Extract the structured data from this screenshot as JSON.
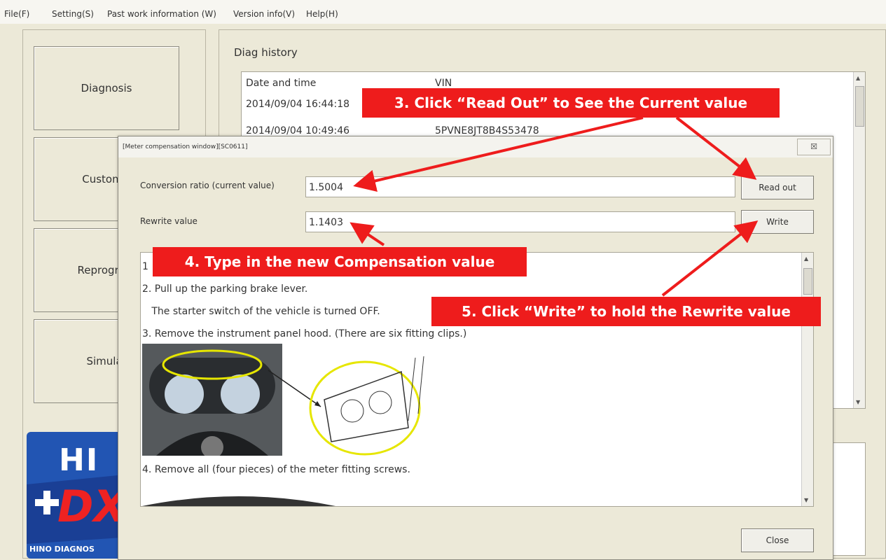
{
  "menu": {
    "file": "File(F)",
    "setting": "Setting(S)",
    "past_work": "Past work information (W)",
    "version": "Version info(V)",
    "help": "Help(H)"
  },
  "sidebar": {
    "diagnosis": "Diagnosis",
    "customize": "Customiz",
    "reprogram": "Reprogram",
    "simulation": "Simulat"
  },
  "logo": {
    "line1": "HI",
    "line2": "DX",
    "subtitle": "HINO DIAGNOS"
  },
  "diag_history": {
    "title": "Diag history",
    "columns": [
      "Date and time",
      "VIN"
    ],
    "rows": [
      [
        "2014/09/04 16:44:18",
        ""
      ],
      [
        "2014/09/04 10:49:46",
        "5PVNE8JT8B4S53478"
      ]
    ]
  },
  "modal": {
    "title": "[Meter compensation window][SC0611]",
    "close_x": "☒",
    "conversion_label": "Conversion ratio (current value)",
    "conversion_value": "1.5004",
    "rewrite_label": "Rewrite value",
    "rewrite_value": "1.1403",
    "read_out": "Read out",
    "write": "Write",
    "close": "Close",
    "instructions": [
      "1",
      "2. Pull up the parking brake lever.",
      "   The starter switch of the vehicle is turned OFF.",
      "3. Remove the instrument panel hood. (There are six fitting clips.)",
      "4. Remove all (four pieces) of the meter fitting screws."
    ]
  },
  "callouts": {
    "c3": "3. Click “Read Out” to See the Current value",
    "c4": "4. Type in the new Compensation value",
    "c5": "5. Click “Write” to hold the Rewrite value"
  },
  "colors": {
    "callout_red": "#ee1c1c",
    "window_bg": "#ece9d8",
    "logo_blue": "#2255b3"
  }
}
